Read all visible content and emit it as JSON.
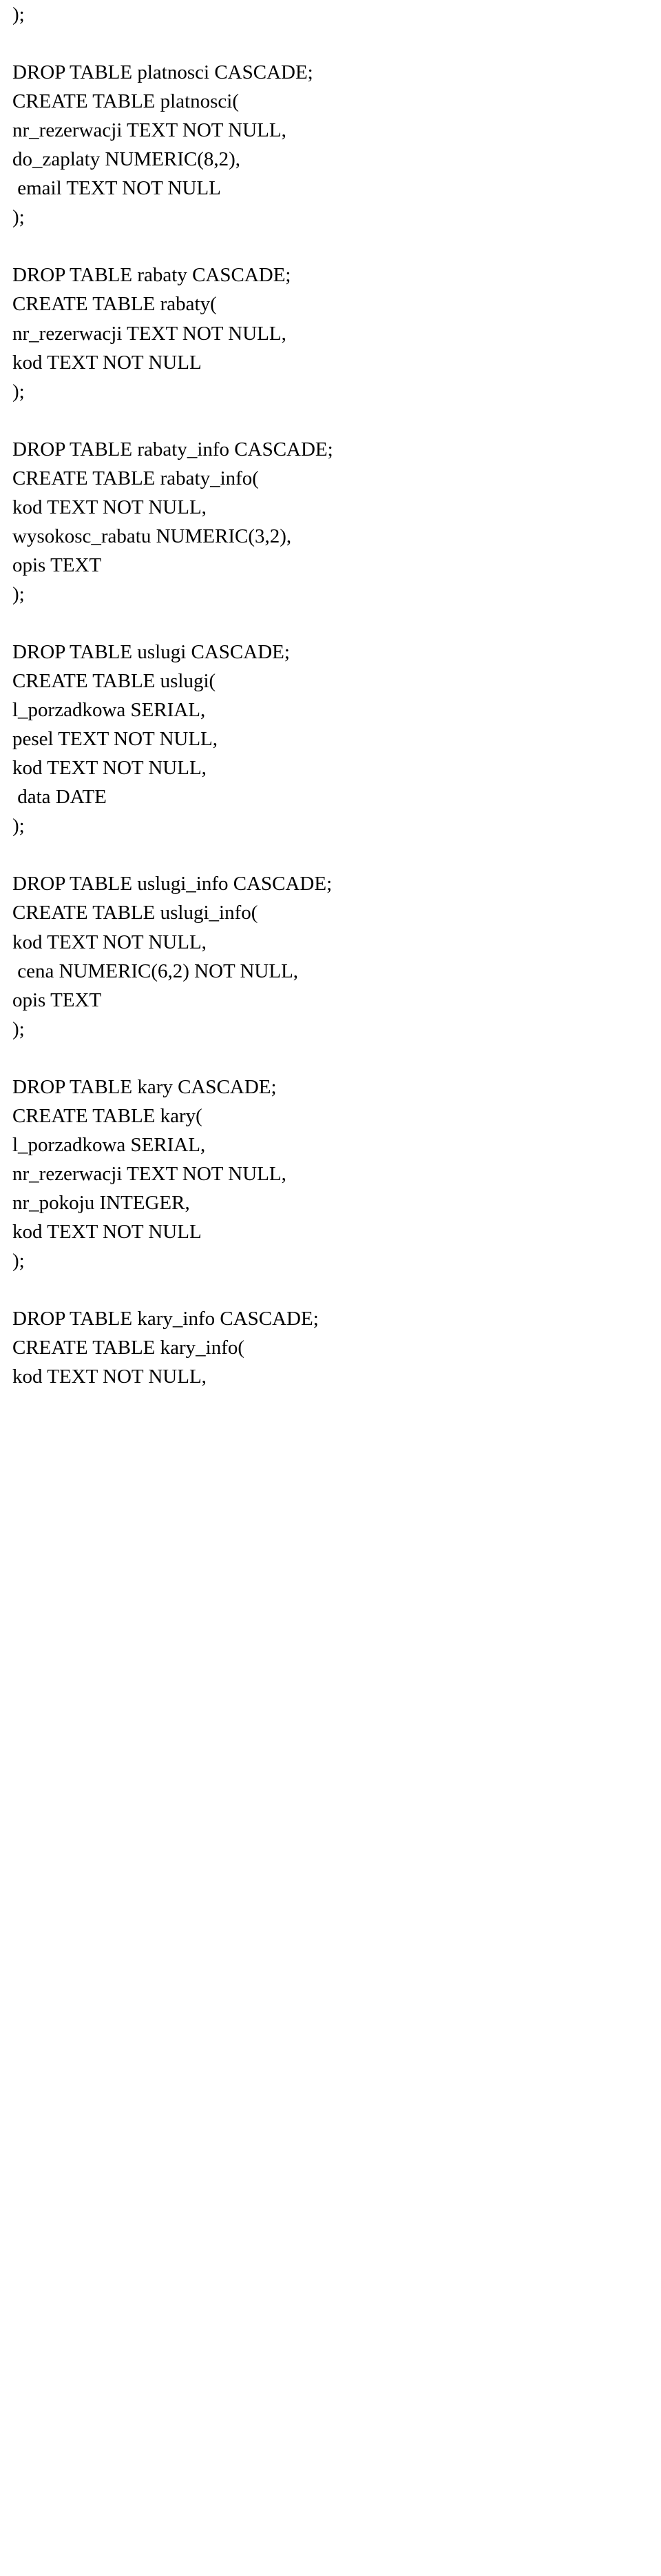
{
  "sql_text": ");\n\nDROP TABLE platnosci CASCADE;\nCREATE TABLE platnosci(\nnr_rezerwacji TEXT NOT NULL,\ndo_zaplaty NUMERIC(8,2),\n email TEXT NOT NULL\n);\n\nDROP TABLE rabaty CASCADE;\nCREATE TABLE rabaty(\nnr_rezerwacji TEXT NOT NULL,\nkod TEXT NOT NULL\n);\n\nDROP TABLE rabaty_info CASCADE;\nCREATE TABLE rabaty_info(\nkod TEXT NOT NULL,\nwysokosc_rabatu NUMERIC(3,2),\nopis TEXT\n);\n\nDROP TABLE uslugi CASCADE;\nCREATE TABLE uslugi(\nl_porzadkowa SERIAL,\npesel TEXT NOT NULL,\nkod TEXT NOT NULL,\n data DATE\n);\n\nDROP TABLE uslugi_info CASCADE;\nCREATE TABLE uslugi_info(\nkod TEXT NOT NULL,\n cena NUMERIC(6,2) NOT NULL,\nopis TEXT\n);\n\nDROP TABLE kary CASCADE;\nCREATE TABLE kary(\nl_porzadkowa SERIAL,\nnr_rezerwacji TEXT NOT NULL,\nnr_pokoju INTEGER,\nkod TEXT NOT NULL\n);\n\nDROP TABLE kary_info CASCADE;\nCREATE TABLE kary_info(\nkod TEXT NOT NULL,"
}
